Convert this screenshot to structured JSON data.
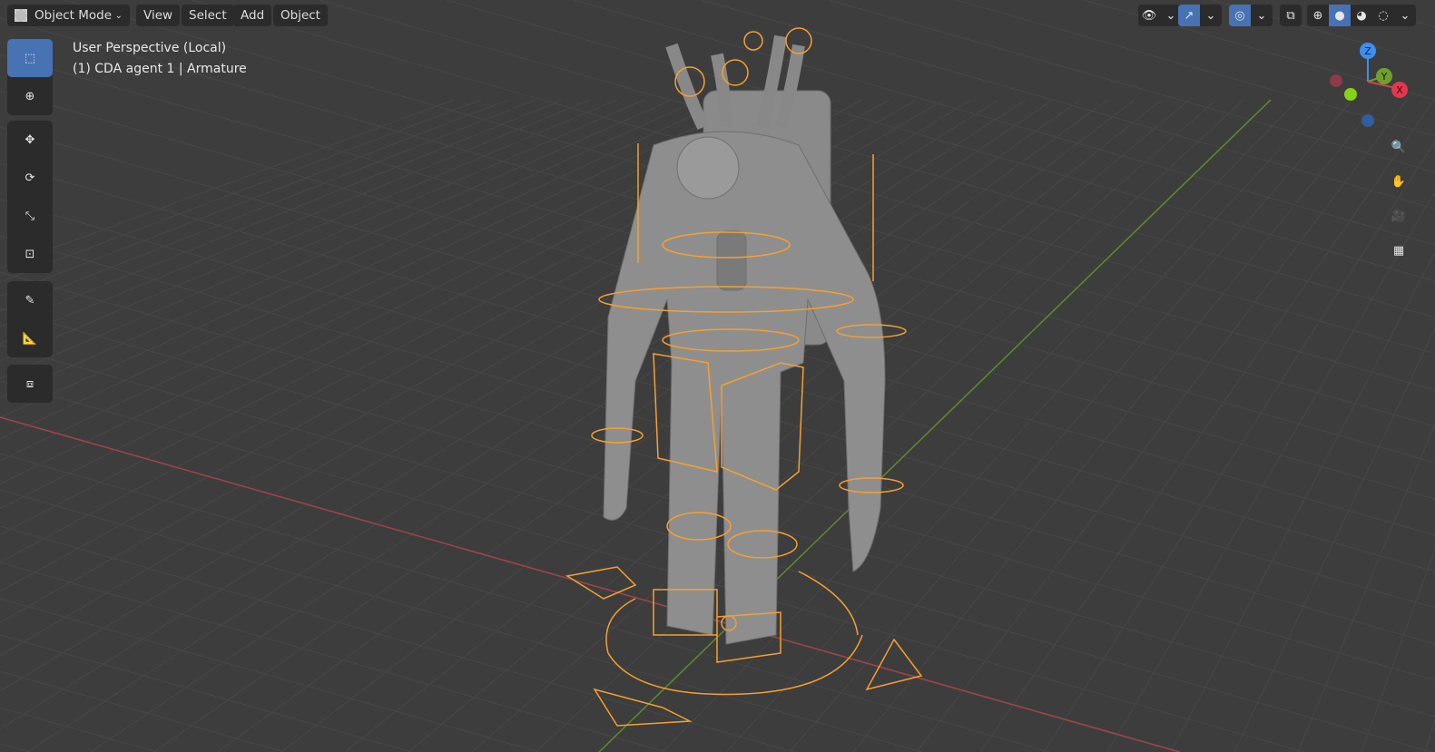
{
  "header": {
    "mode": "Object Mode",
    "menus": [
      "View",
      "Select",
      "Add",
      "Object"
    ]
  },
  "overlay_text": {
    "view_name": "User Perspective (Local)",
    "object_info": "(1) CDA agent 1 | Armature"
  },
  "gizmo": {
    "z": "Z",
    "y": "Y",
    "x": "X"
  },
  "colors": {
    "background": "#3d3d3d",
    "accent": "#4772b3",
    "armature": "#f5a030",
    "x_axis": "#d4414f",
    "y_axis": "#6ea12a",
    "z_axis": "#3d8ef0"
  }
}
